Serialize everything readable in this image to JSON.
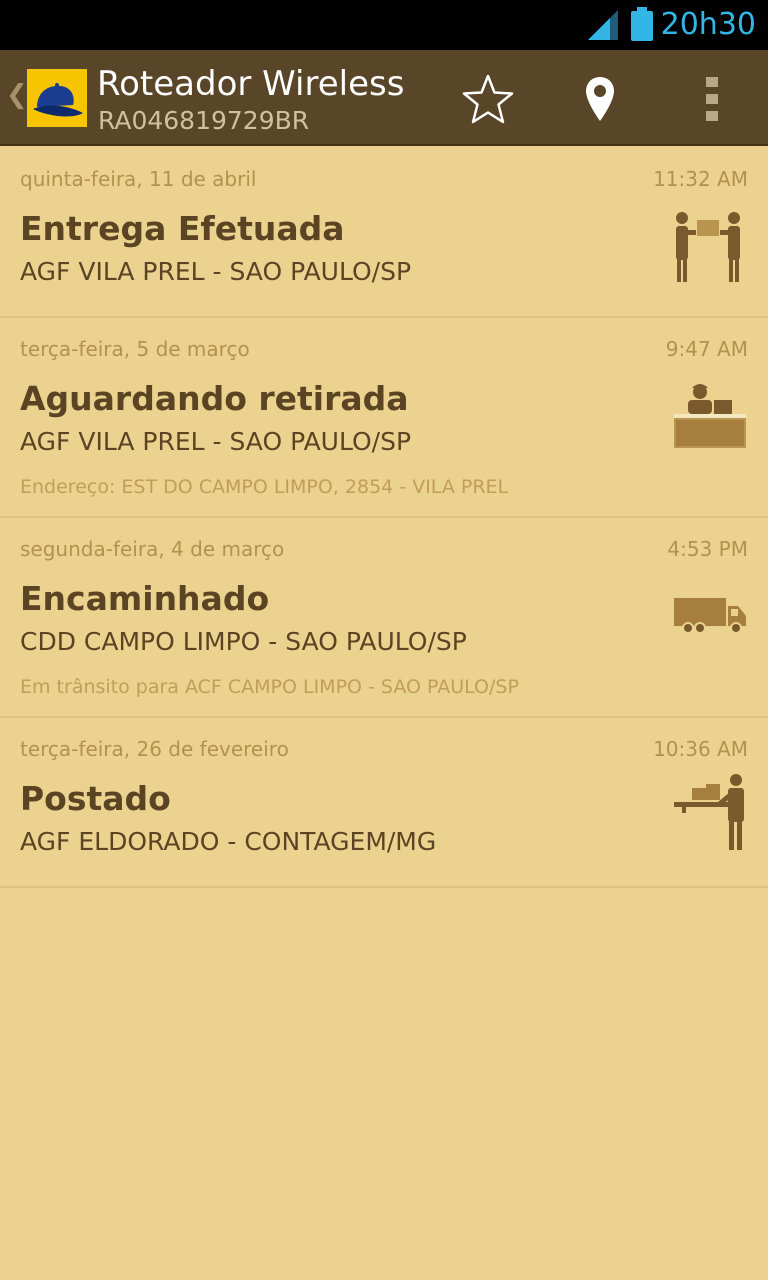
{
  "status_bar": {
    "clock": "20h30",
    "icons": [
      "signal-icon",
      "battery-icon"
    ],
    "clock_color": "#33b5e5"
  },
  "action_bar": {
    "title": "Roteador Wireless",
    "subtitle": "RA046819729BR",
    "actions": [
      "star-icon",
      "map-pin-icon",
      "overflow-menu-icon"
    ],
    "background": "#594527"
  },
  "tracking_events": [
    {
      "date": "quinta-feira, 11 de abril",
      "time": "11:32 AM",
      "status": "Entrega Efetuada",
      "location": "AGF VILA PREL - SAO PAULO/SP",
      "detail": "",
      "icon": "delivery-handoff-icon"
    },
    {
      "date": "terça-feira, 5 de março",
      "time": "9:47 AM",
      "status": "Aguardando retirada",
      "location": "AGF VILA PREL - SAO PAULO/SP",
      "detail": "Endereço: EST DO CAMPO LIMPO, 2854 - VILA PREL",
      "icon": "counter-clerk-icon"
    },
    {
      "date": "segunda-feira, 4 de março",
      "time": "4:53 PM",
      "status": "Encaminhado",
      "location": "CDD CAMPO LIMPO - SAO PAULO/SP",
      "detail": "Em trânsito para ACF CAMPO LIMPO - SAO PAULO/SP",
      "icon": "truck-icon"
    },
    {
      "date": "terça-feira, 26 de fevereiro",
      "time": "10:36 AM",
      "status": "Postado",
      "location": "AGF ELDORADO - CONTAGEM/MG",
      "detail": "",
      "icon": "posting-person-icon"
    }
  ],
  "colors": {
    "background": "#ebd38f",
    "text_primary": "#5b4424",
    "text_secondary": "#b3914f",
    "divider": "#dcc282"
  }
}
